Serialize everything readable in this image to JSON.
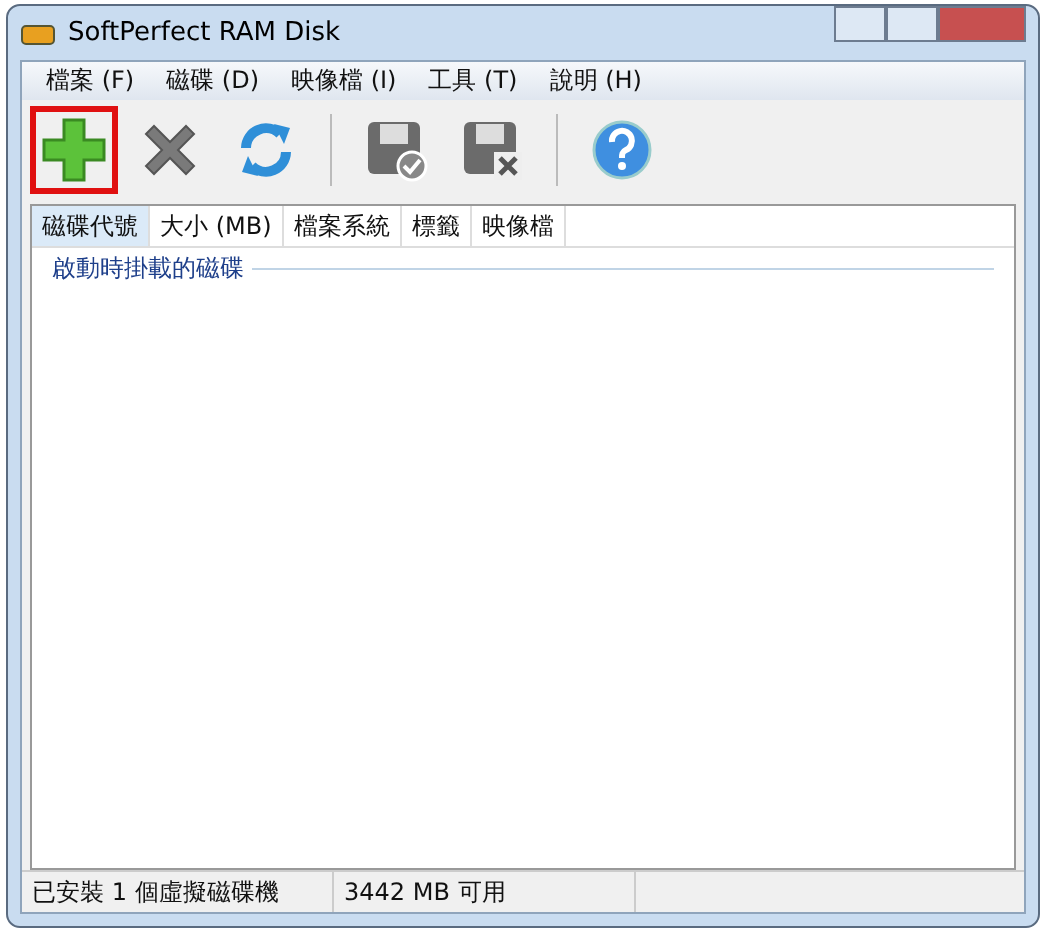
{
  "window": {
    "title": "SoftPerfect RAM Disk"
  },
  "menu": [
    "檔案 (F)",
    "磁碟 (D)",
    "映像檔 (I)",
    "工具 (T)",
    "說明 (H)"
  ],
  "toolbar": [
    {
      "kind": "add",
      "highlighted": true
    },
    {
      "kind": "remove",
      "highlighted": false
    },
    {
      "kind": "refresh",
      "highlighted": false
    },
    {
      "kind": "separator"
    },
    {
      "kind": "save-disk",
      "highlighted": false
    },
    {
      "kind": "delete-disk",
      "highlighted": false
    },
    {
      "kind": "separator"
    },
    {
      "kind": "help",
      "highlighted": false
    }
  ],
  "table": {
    "columns": [
      {
        "label": "磁碟代號",
        "selected": true
      },
      {
        "label": "大小 (MB)",
        "selected": false
      },
      {
        "label": "檔案系統",
        "selected": false
      },
      {
        "label": "標籤",
        "selected": false
      },
      {
        "label": "映像檔",
        "selected": false
      }
    ],
    "group": "啟動時掛載的磁碟"
  },
  "status_bar": [
    "已安裝 1 個虛擬磁碟機",
    "3442 MB 可用"
  ]
}
